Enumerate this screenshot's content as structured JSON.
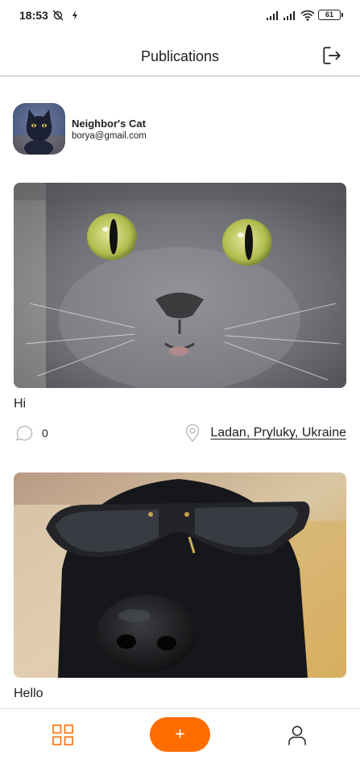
{
  "status_bar": {
    "time": "18:53",
    "battery": "61",
    "icons": [
      "alarm-off-icon",
      "bolt-icon",
      "signal-icon",
      "signal-icon",
      "wifi-icon",
      "battery-icon"
    ]
  },
  "header": {
    "title": "Publications",
    "logout_icon": "logout-icon"
  },
  "profile": {
    "name": "Neighbor's Cat",
    "email": "borya@gmail.com"
  },
  "posts": [
    {
      "title": "Hi",
      "comments": "0",
      "location": "Ladan, Pryluky, Ukraine",
      "image": "photo of a grey cat close-up"
    },
    {
      "title": "Hello",
      "image": "photo of a black dog wearing sunglasses"
    }
  ],
  "bottom_nav": {
    "add_label": "+",
    "items": [
      "grid-icon",
      "add-button",
      "user-icon"
    ]
  },
  "colors": {
    "accent": "#FF6C00",
    "text": "#212121",
    "divider": "#BDBDBD",
    "icon": "#BDBDBD"
  }
}
